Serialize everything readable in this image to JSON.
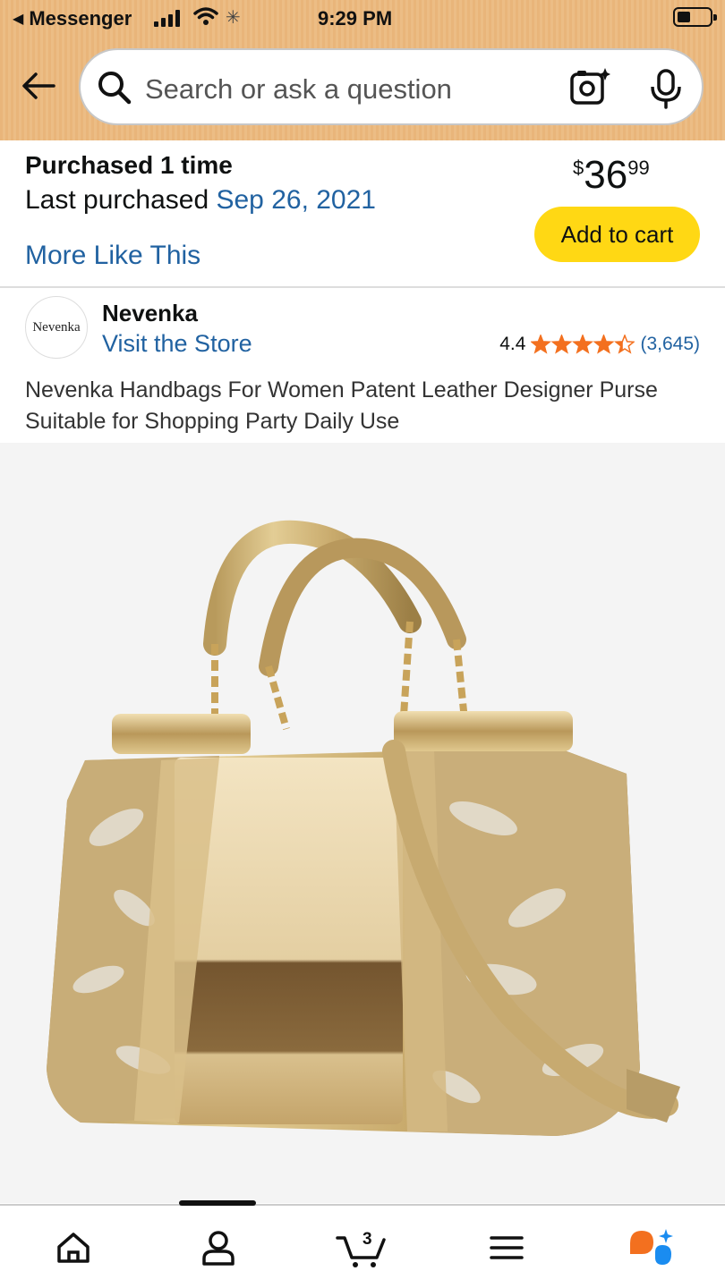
{
  "status_bar": {
    "back_app": "Messenger",
    "time": "9:29 PM"
  },
  "search": {
    "placeholder": "Search or ask a question",
    "icons": [
      "back-arrow-icon",
      "search-icon",
      "camera-lens-icon",
      "microphone-icon"
    ]
  },
  "purchase": {
    "times_label": "Purchased 1 time",
    "last_label": "Last purchased",
    "last_date": "Sep 26, 2021",
    "more_link": "More Like This",
    "price_currency": "$",
    "price_whole": "36",
    "price_fraction": "99",
    "add_to_cart": "Add to cart",
    "button_color": "#ffd814",
    "link_color": "#2162a1"
  },
  "store": {
    "logo_text": "Nevenka",
    "brand": "Nevenka",
    "visit_link": "Visit the Store",
    "rating": "4.4",
    "star_fraction": 0.88,
    "review_count": "(3,645)",
    "star_color": "#f3701f"
  },
  "product": {
    "title": "Nevenka Handbags For Women Patent Leather Designer Purse Suitable for Shopping Party Daily Use"
  },
  "bottom_nav": {
    "cart_count": "3",
    "tabs": [
      "home-icon",
      "account-icon",
      "cart-icon",
      "menu-icon",
      "rufus-assistant-icon"
    ]
  }
}
